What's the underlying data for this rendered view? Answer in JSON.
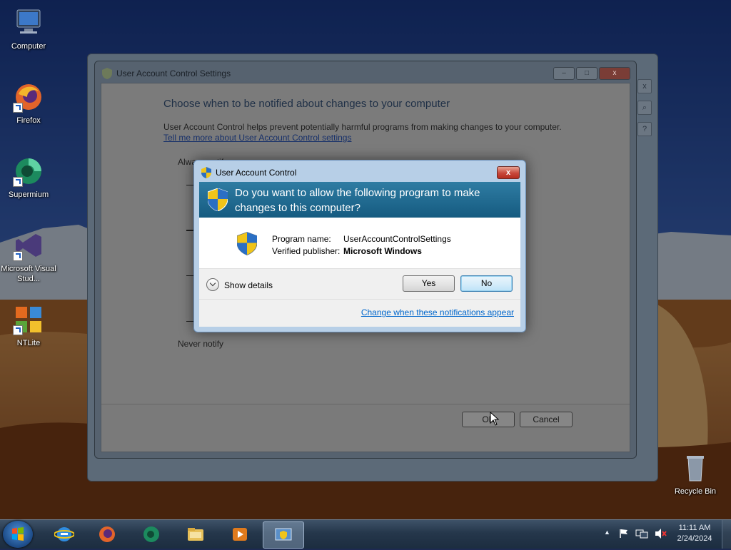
{
  "desktop": {
    "icons": [
      {
        "label": "Computer"
      },
      {
        "label": "Firefox"
      },
      {
        "label": "Supermium"
      },
      {
        "label": "Microsoft Visual Stud..."
      },
      {
        "label": "NTLite"
      },
      {
        "label": "Recycle Bin"
      }
    ]
  },
  "uac_settings": {
    "title": "User Account Control Settings",
    "heading": "Choose when to be notified about changes to your computer",
    "description": "User Account Control helps prevent potentially harmful programs from making changes to your computer.",
    "link": "Tell me more about User Account Control settings",
    "always_notify": "Always notify",
    "never_notify": "Never notify",
    "ok_label": "OK",
    "cancel_label": "Cancel"
  },
  "uac_prompt": {
    "title": "User Account Control",
    "question": "Do you want to allow the following program to make changes to this computer?",
    "program_name_key": "Program name:",
    "program_name_value": "UserAccountControlSettings",
    "publisher_key": "Verified publisher:",
    "publisher_value": "Microsoft Windows",
    "show_details": "Show details",
    "yes_label": "Yes",
    "no_label": "No",
    "change_link": "Change when these notifications appear",
    "close_glyph": "x"
  },
  "taskbar": {
    "items": [
      {
        "icon": "internet-explorer-icon"
      },
      {
        "icon": "firefox-icon"
      },
      {
        "icon": "supermium-icon"
      },
      {
        "icon": "file-explorer-icon"
      },
      {
        "icon": "media-player-icon"
      },
      {
        "icon": "uac-settings-icon",
        "active": true
      }
    ],
    "time": "11:11 AM",
    "date": "2/24/2024",
    "tray_arrow": "▲"
  },
  "colors": {
    "banner": "#155b80",
    "link": "#0066cc",
    "close_red": "#c7473a"
  }
}
